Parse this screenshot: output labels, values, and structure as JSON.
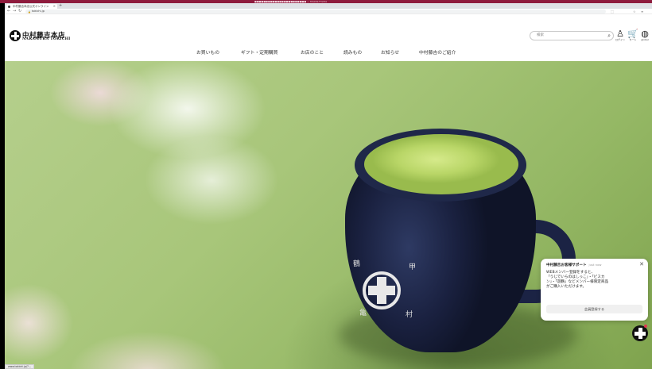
{
  "window": {
    "title": "■■■■■■■■■■■■■■■■■■■■■■■ — Mozilla Firefox"
  },
  "browser": {
    "tab_title": "中村藤吉本店公式オンライン",
    "url": "tokichi.jp",
    "status_url": "www.tokichi.jp/?..."
  },
  "header": {
    "logo_jp": "中村藤吉本店",
    "logo_en": "NAKAMURA TOKICHI",
    "search_placeholder": "検索",
    "icons": [
      {
        "name": "login",
        "caption": "ログイン"
      },
      {
        "name": "cart",
        "caption": "カート"
      },
      {
        "name": "global",
        "caption": "global"
      }
    ]
  },
  "nav": {
    "items": [
      "お買いもの",
      "ギフト・定期購買",
      "お店のこと",
      "読みもの",
      "お知らせ",
      "中村藤吉のご紹介"
    ]
  },
  "hero": {
    "mug_chars": [
      "鶴",
      "甲",
      "亀",
      "村"
    ]
  },
  "chat": {
    "title": "中村藤吉お客様サポート",
    "time": "just now",
    "body_lines": [
      "WEBメンバー登録をすると、",
      "「うじでいらのはしっこ」・「ビスカ",
      "ン」・「遊鶴」などメンバー様限定商品",
      "がご購入いただけます。"
    ],
    "button": "会員登録する"
  },
  "colors": {
    "os_titlebar": "#8e1b3d",
    "matcha": "#b9d667",
    "mug": "#1a2140",
    "fab_badge": "#e0364f"
  }
}
